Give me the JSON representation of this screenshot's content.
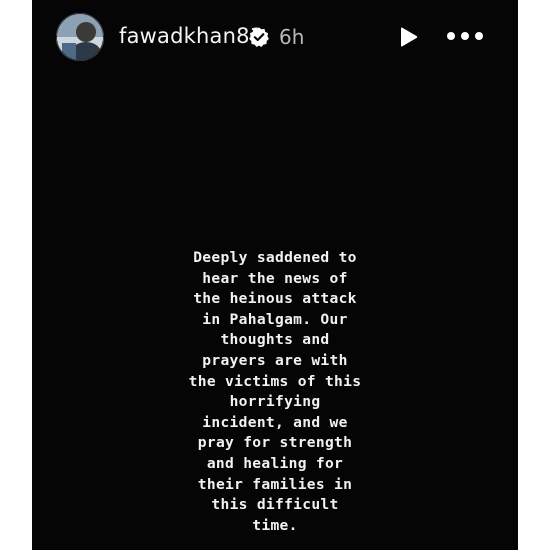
{
  "header": {
    "username": "fawadkhan81",
    "timestamp": "6h",
    "verified": true,
    "avatar_icon": "profile-photo",
    "play_icon": "play-icon",
    "more_icon": "more-dots-icon"
  },
  "story": {
    "background": "#050505",
    "text_lines": [
      "Deeply saddened to",
      "hear the news of",
      "the heinous attack",
      "in Pahalgam. Our",
      "thoughts and",
      "prayers are with",
      "the victims of this",
      "horrifying",
      "incident, and we",
      "pray for strength",
      "and healing for",
      "their families in",
      "this difficult",
      "time."
    ]
  },
  "colors": {
    "verified_badge": "#ffffff",
    "text": "#f2f2f2"
  }
}
